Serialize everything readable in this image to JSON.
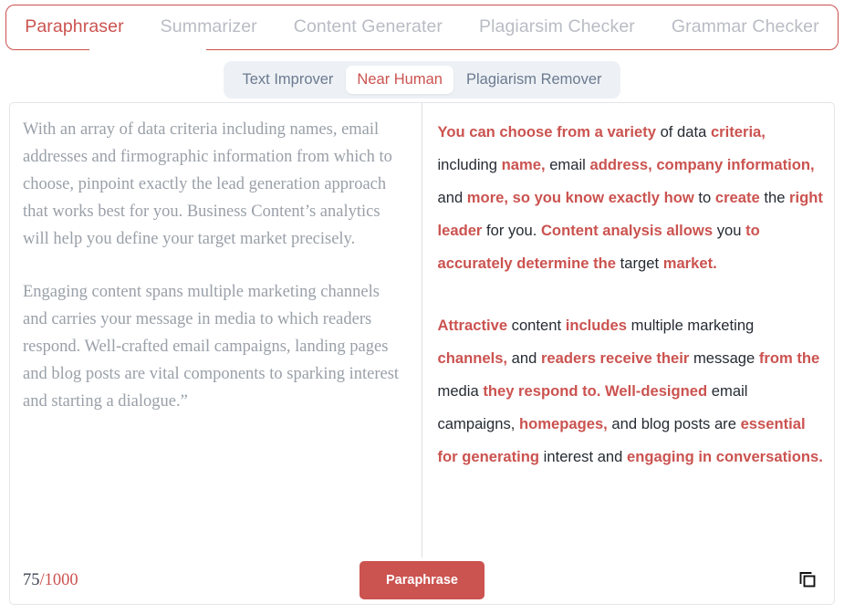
{
  "tabs": {
    "items": [
      {
        "label": "Paraphraser",
        "active": true
      },
      {
        "label": "Summarizer",
        "active": false
      },
      {
        "label": "Content Generater",
        "active": false
      },
      {
        "label": "Plagiarsim Checker",
        "active": false
      },
      {
        "label": "Grammar Checker",
        "active": false
      }
    ]
  },
  "subtabs": {
    "items": [
      {
        "label": "Text Improver",
        "active": false
      },
      {
        "label": "Near Human",
        "active": true
      },
      {
        "label": "Plagiarism Remover",
        "active": false
      }
    ]
  },
  "source": {
    "paragraphs": [
      "With an array of data criteria including names, email addresses and firmographic information from which to choose, pinpoint exactly the lead generation approach that works best for you. Business Content’s analytics will help you define your target market precisely.",
      "Engaging content spans multiple marketing channels and carries your message in media to which readers respond. Well-crafted email campaigns, landing pages and blog posts are vital components to sparking interest and starting a dialogue.”"
    ]
  },
  "output": {
    "paragraphs": [
      [
        {
          "t": "You can choose from a variety",
          "hl": true
        },
        {
          "t": " of data ",
          "hl": false
        },
        {
          "t": "criteria,",
          "hl": true
        },
        {
          "t": " including ",
          "hl": false
        },
        {
          "t": "name,",
          "hl": true
        },
        {
          "t": " email ",
          "hl": false
        },
        {
          "t": "address, company information,",
          "hl": true
        },
        {
          "t": " and ",
          "hl": false
        },
        {
          "t": "more, so you know exactly how",
          "hl": true
        },
        {
          "t": " to ",
          "hl": false
        },
        {
          "t": "create",
          "hl": true
        },
        {
          "t": " the ",
          "hl": false
        },
        {
          "t": "right leader",
          "hl": true
        },
        {
          "t": " for you. ",
          "hl": false
        },
        {
          "t": "Content analysis allows",
          "hl": true
        },
        {
          "t": " you ",
          "hl": false
        },
        {
          "t": "to accurately determine the",
          "hl": true
        },
        {
          "t": " target ",
          "hl": false
        },
        {
          "t": "market.",
          "hl": true
        }
      ],
      [
        {
          "t": "Attractive",
          "hl": true
        },
        {
          "t": " content ",
          "hl": false
        },
        {
          "t": "includes",
          "hl": true
        },
        {
          "t": " multiple marketing ",
          "hl": false
        },
        {
          "t": "channels,",
          "hl": true
        },
        {
          "t": " and ",
          "hl": false
        },
        {
          "t": "readers receive their",
          "hl": true
        },
        {
          "t": " message ",
          "hl": false
        },
        {
          "t": "from the",
          "hl": true
        },
        {
          "t": " media ",
          "hl": false
        },
        {
          "t": "they respond to. Well-designed",
          "hl": true
        },
        {
          "t": " email campaigns, ",
          "hl": false
        },
        {
          "t": "homepages,",
          "hl": true
        },
        {
          "t": " and blog posts are ",
          "hl": false
        },
        {
          "t": "essential for generating",
          "hl": true
        },
        {
          "t": " interest and ",
          "hl": false
        },
        {
          "t": "engaging in conversations.",
          "hl": true
        }
      ]
    ]
  },
  "footer": {
    "char_count": "75",
    "char_limit": "/1000",
    "cta_label": "Paraphrase",
    "copy_icon": "copy-icon"
  },
  "colors": {
    "accent": "#cb5350",
    "source_text": "#9aa0a8",
    "output_text": "#262b33",
    "subtab_bg": "#edf1f5",
    "border": "#e3e5e8"
  }
}
